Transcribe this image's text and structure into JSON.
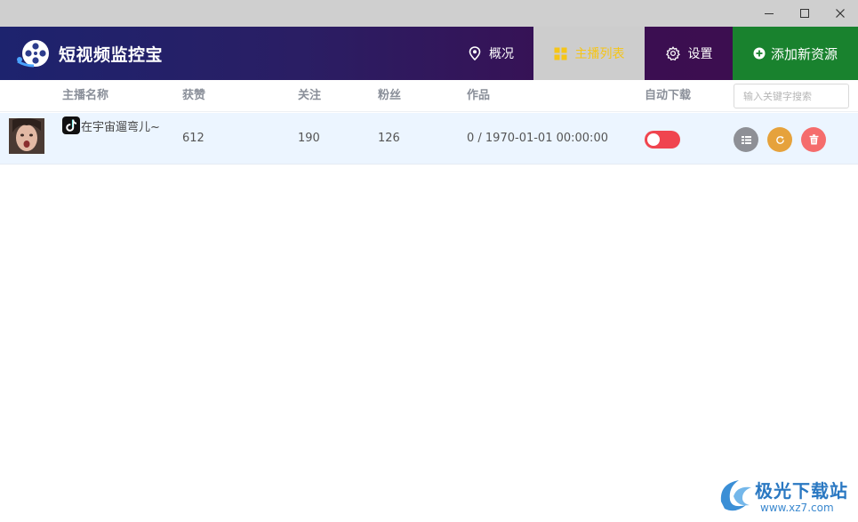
{
  "window": {
    "controls": [
      "minimize",
      "maximize",
      "close"
    ]
  },
  "header": {
    "brand_title": "短视频监控宝",
    "nav": {
      "overview": "概况",
      "anchor_list": "主播列表",
      "settings": "设置",
      "add_resource": "添加新资源"
    },
    "colors": {
      "active_text": "#f5c518",
      "add_button": "#19822e"
    }
  },
  "table": {
    "headers": {
      "name": "主播名称",
      "likes": "获赞",
      "following": "关注",
      "fans": "粉丝",
      "works": "作品",
      "auto_download": "自动下载"
    },
    "search_placeholder": "输入关键字搜索",
    "rows": [
      {
        "name": "在宇宙遛弯儿~",
        "likes": "612",
        "following": "190",
        "fans": "126",
        "works": "0 / 1970-01-01 00:00:00",
        "auto_download": false
      }
    ]
  },
  "watermark": {
    "text": "极光下载站",
    "url": "www.xz7.com"
  }
}
